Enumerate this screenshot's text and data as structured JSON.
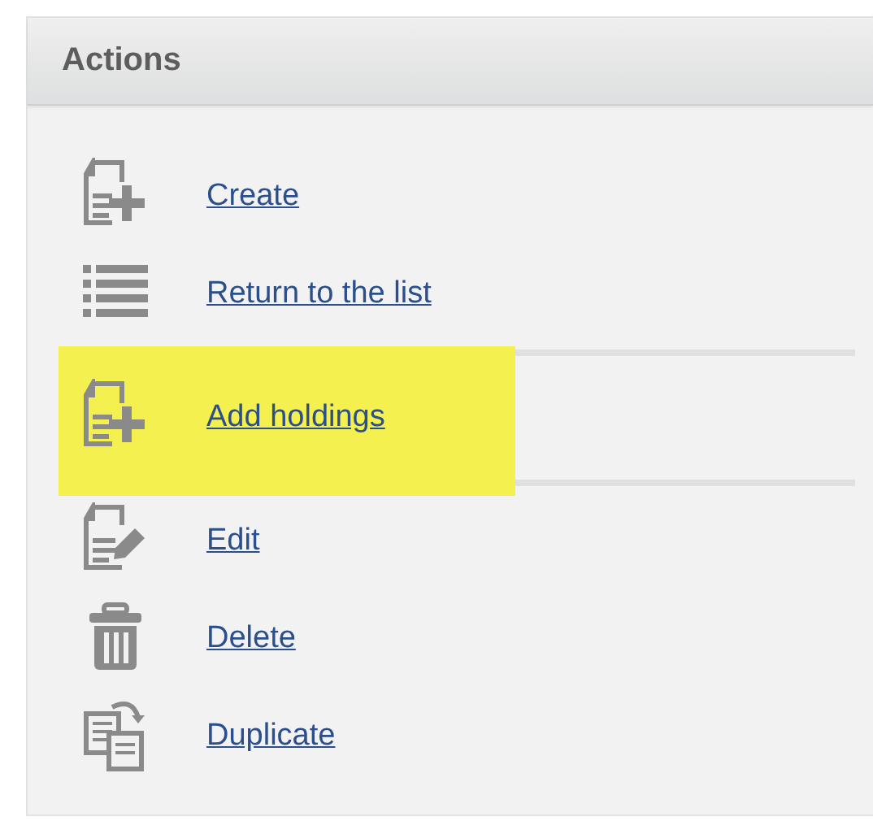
{
  "panel": {
    "title": "Actions"
  },
  "sections": [
    {
      "highlighted": false,
      "items": [
        {
          "kind": "create",
          "label": "Create"
        },
        {
          "kind": "list",
          "label": "Return to the list"
        }
      ]
    },
    {
      "highlighted": true,
      "items": [
        {
          "kind": "create",
          "label": "Add holdings"
        }
      ]
    },
    {
      "highlighted": false,
      "items": [
        {
          "kind": "edit",
          "label": "Edit"
        },
        {
          "kind": "delete",
          "label": "Delete"
        },
        {
          "kind": "duplicate",
          "label": "Duplicate"
        }
      ]
    }
  ]
}
